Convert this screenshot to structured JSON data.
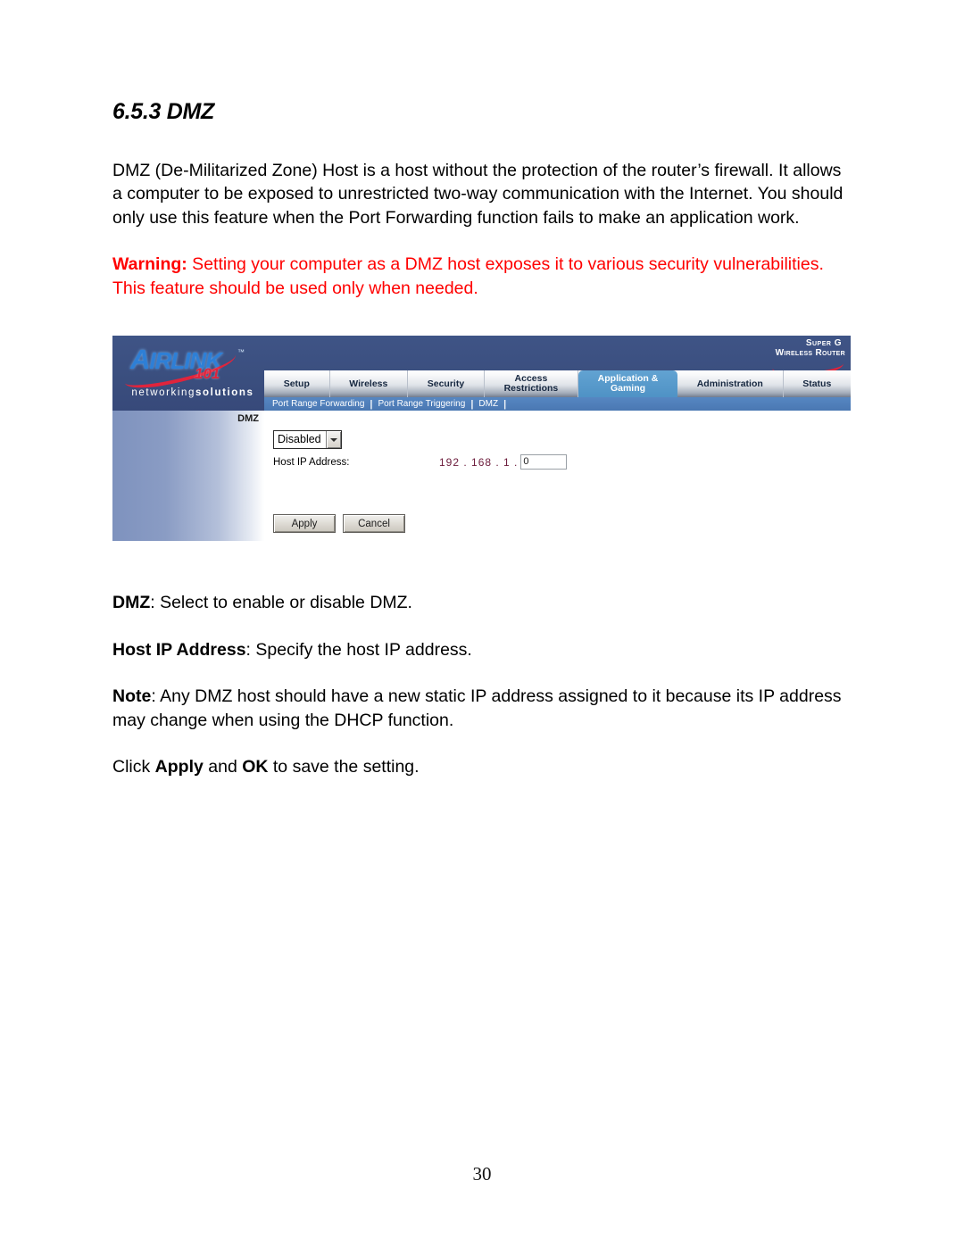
{
  "document": {
    "heading": "6.5.3 DMZ",
    "intro_paragraph": "DMZ (De-Militarized Zone) Host is a host without the protection of the router’s firewall. It allows a computer to be exposed to unrestricted two-way communication with the Internet. You should only use this feature when the Port Forwarding function fails to make an application work.",
    "warning_label": "Warning:",
    "warning_text": " Setting your computer as a DMZ host exposes it to various security vulnerabilities. This feature should be used only when needed.",
    "dmz_term": "DMZ",
    "dmz_definition": ": Select to enable or disable DMZ.",
    "host_term": "Host IP Address",
    "host_definition": ": Specify the host IP address.",
    "note_label": "Note",
    "note_text": ": Any DMZ host should have a new static IP address assigned to it because its IP address may change when using the DHCP function.",
    "click_prefix": "Click ",
    "click_apply": "Apply",
    "click_middle": " and ",
    "click_ok": "OK",
    "click_suffix": " to save the setting.",
    "page_number": "30",
    "warning_color": "#ff0000"
  },
  "screenshot": {
    "brand": {
      "logo_a": "A",
      "logo_name": "IRLINK",
      "logo_number": "101",
      "logo_tm": "™",
      "tagline_thin": "networking",
      "tagline_bold": "solutions",
      "superg_line1": "Super G",
      "superg_line2": "Wireless Router"
    },
    "nav_tabs": [
      {
        "label": "Setup",
        "active": false
      },
      {
        "label": "Wireless",
        "active": false
      },
      {
        "label": "Security",
        "active": false
      },
      {
        "label": "Access\nRestrictions",
        "active": false
      },
      {
        "label": "Application &\nGaming",
        "active": true
      },
      {
        "label": "Administration",
        "active": false
      },
      {
        "label": "Status",
        "active": false
      }
    ],
    "sub_tabs": [
      {
        "label": "Port Range Forwarding"
      },
      {
        "label": "Port Range Triggering"
      },
      {
        "label": "DMZ"
      }
    ],
    "sub_tab_separator": "|",
    "side_panel_title": "DMZ",
    "form": {
      "dmz_state": "Disabled",
      "host_ip_label": "Host IP Address:",
      "ip_prefix": "192 . 168 . 1 .",
      "ip_last_octet": "0",
      "apply_button": "Apply",
      "cancel_button": "Cancel"
    },
    "colors": {
      "header_blue": "#3a4e7e",
      "active_tab_blue": "#4f92c5",
      "subnav_blue": "#4f7fba",
      "logo_blue": "#2e7fd6",
      "logo_red": "#e0243c",
      "ip_text": "#6b1a3a"
    }
  }
}
